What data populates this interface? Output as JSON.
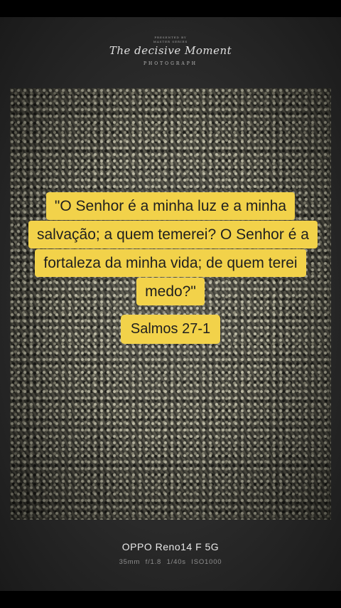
{
  "watermark": {
    "line1": "PRESENTED BY",
    "line2": "MASTER SERIES",
    "signature": "The decisive Moment",
    "sub": "PHOTOGRAPH"
  },
  "quote": {
    "lines": [
      "\"O Senhor é a minha luz e a minha",
      "salvação; a quem temerei? O Senhor é a",
      "fortaleza da minha vida; de quem terei",
      "medo?\""
    ],
    "reference": "Salmos 27-1"
  },
  "footer": {
    "device": "OPPO Reno14 F 5G",
    "exif": {
      "focal": "35mm",
      "aperture": "f/1.8",
      "shutter": "1/40s",
      "iso": "ISO1000"
    }
  },
  "colors": {
    "highlight": "#f2d24a",
    "text": "#1f1f1f",
    "background": "#000000"
  }
}
